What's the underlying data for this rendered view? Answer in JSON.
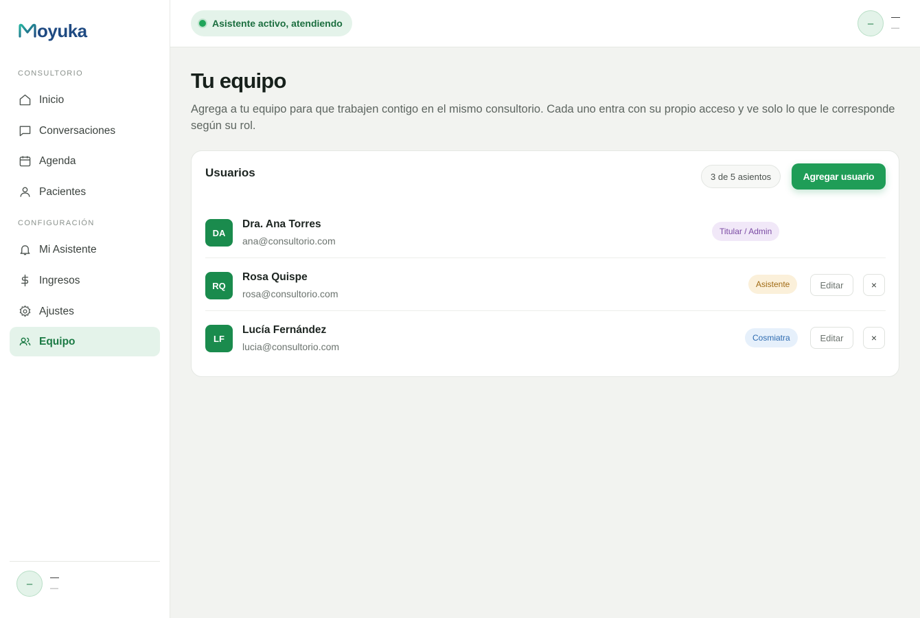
{
  "brand": {
    "name": "oyuka"
  },
  "sidebar": {
    "sections": [
      {
        "label": "CONSULTORIO"
      },
      {
        "label": "CONFIGURACIÓN"
      }
    ],
    "items": [
      {
        "label": "Inicio",
        "icon": "home-icon"
      },
      {
        "label": "Conversaciones",
        "icon": "chat-icon"
      },
      {
        "label": "Agenda",
        "icon": "calendar-icon"
      },
      {
        "label": "Pacientes",
        "icon": "user-icon"
      },
      {
        "label": "Mi Asistente",
        "icon": "bell-icon"
      },
      {
        "label": "Ingresos",
        "icon": "dollar-icon"
      },
      {
        "label": "Ajustes",
        "icon": "gear-icon"
      },
      {
        "label": "Equipo",
        "icon": "users-icon",
        "active": true
      }
    ],
    "user": {
      "initials": "–",
      "name": "—",
      "role": "—"
    }
  },
  "header": {
    "status": "Asistente activo, atendiendo",
    "user": {
      "initials": "–",
      "name": "—",
      "role": "—"
    }
  },
  "main": {
    "title": "Tu equipo",
    "description": "Agrega a tu equipo para que trabajen contigo en el mismo consultorio. Cada uno entra con su propio acceso y ve solo lo que le corresponde según su rol.",
    "card": {
      "title": "Usuarios",
      "seats": "3 de 5 asientos",
      "add_label": "Agregar usuario",
      "users": [
        {
          "initials": "DA",
          "name": "Dra. Ana Torres",
          "email": "ana@consultorio.com",
          "role": "Titular / Admin"
        },
        {
          "initials": "RQ",
          "name": "Rosa Quispe",
          "email": "rosa@consultorio.com",
          "role": "Asistente",
          "edit": "Editar",
          "remove": "×"
        },
        {
          "initials": "LF",
          "name": "Lucía Fernández",
          "email": "lucia@consultorio.com",
          "role": "Cosmiatra",
          "edit": "Editar",
          "remove": "×"
        }
      ]
    }
  },
  "colors": {
    "accent": "#1f9d57",
    "active_bg": "#e4f3ea",
    "brand_blue": "#1f4a82"
  }
}
